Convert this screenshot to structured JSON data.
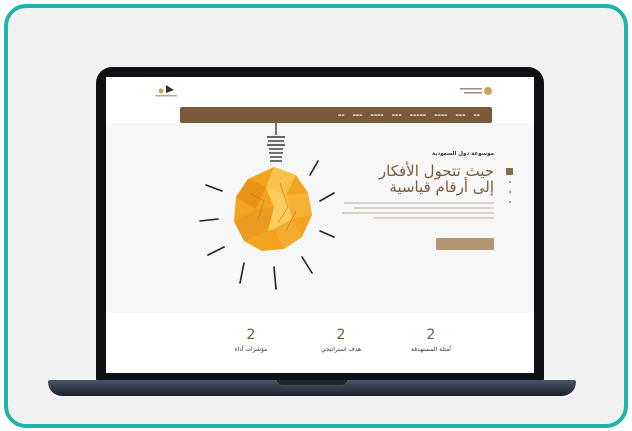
{
  "hero": {
    "eyebrow": "موسوعة دول السعودية",
    "headline_line1": "حيث تتحول الأفكار",
    "headline_line2": "إلى أرقام قياسية"
  },
  "stats": [
    {
      "number": "2",
      "label": "أمثلة المستهدفة"
    },
    {
      "number": "2",
      "label": "هدف استراتيجي"
    },
    {
      "number": "2",
      "label": "مؤشرات أداء"
    }
  ],
  "colors": {
    "frame": "#1fb3a9",
    "brand_brown": "#7a5a3a",
    "cta": "#b49572",
    "bulb": "#f3a41f"
  }
}
